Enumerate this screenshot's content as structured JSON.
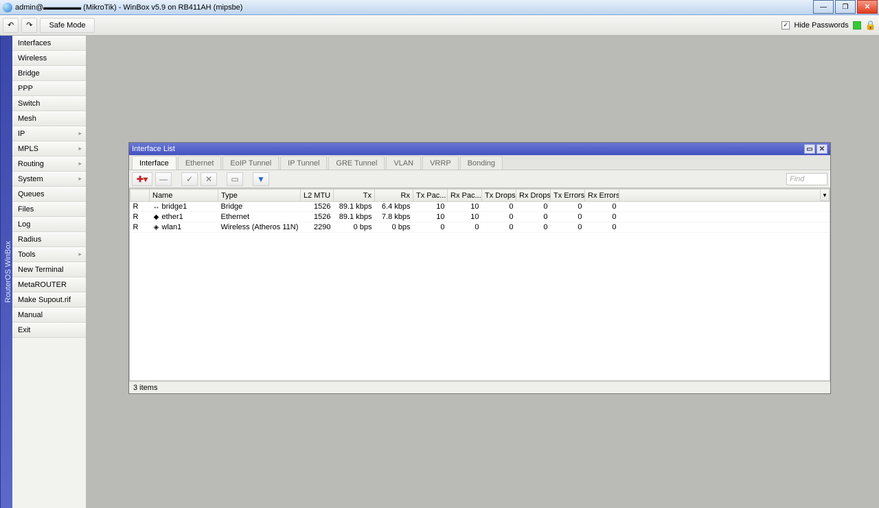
{
  "titlebar": {
    "text": "admin@▬▬▬▬▬ (MikroTik) - WinBox v5.9 on RB411AH (mipsbe)"
  },
  "toolbar": {
    "undo_glyph": "↶",
    "redo_glyph": "↷",
    "safe_mode": "Safe Mode",
    "hide_passwords": "Hide Passwords",
    "hide_passwords_checked": "✓"
  },
  "vbar_label": "RouterOS WinBox",
  "sidebar": {
    "items": [
      {
        "label": "Interfaces",
        "sub": false
      },
      {
        "label": "Wireless",
        "sub": false
      },
      {
        "label": "Bridge",
        "sub": false
      },
      {
        "label": "PPP",
        "sub": false
      },
      {
        "label": "Switch",
        "sub": false
      },
      {
        "label": "Mesh",
        "sub": false
      },
      {
        "label": "IP",
        "sub": true
      },
      {
        "label": "MPLS",
        "sub": true
      },
      {
        "label": "Routing",
        "sub": true
      },
      {
        "label": "System",
        "sub": true
      },
      {
        "label": "Queues",
        "sub": false
      },
      {
        "label": "Files",
        "sub": false
      },
      {
        "label": "Log",
        "sub": false
      },
      {
        "label": "Radius",
        "sub": false
      },
      {
        "label": "Tools",
        "sub": true
      },
      {
        "label": "New Terminal",
        "sub": false
      },
      {
        "label": "MetaROUTER",
        "sub": false
      },
      {
        "label": "Make Supout.rif",
        "sub": false
      },
      {
        "label": "Manual",
        "sub": false
      },
      {
        "label": "Exit",
        "sub": false
      }
    ]
  },
  "inner": {
    "title": "Interface List",
    "tabs": [
      "Interface",
      "Ethernet",
      "EoIP Tunnel",
      "IP Tunnel",
      "GRE Tunnel",
      "VLAN",
      "VRRP",
      "Bonding"
    ],
    "active_tab": 0,
    "find_placeholder": "Find",
    "columns": [
      "",
      "Name",
      "Type",
      "L2 MTU",
      "Tx",
      "Rx",
      "Tx Pac...",
      "Rx Pac...",
      "Tx Drops",
      "Rx Drops",
      "Tx Errors",
      "Rx Errors"
    ],
    "rows": [
      {
        "flag": "R",
        "icon": "↔",
        "name": "bridge1",
        "type": "Bridge",
        "l2mtu": "1526",
        "tx": "89.1 kbps",
        "rx": "6.4 kbps",
        "txp": "10",
        "rxp": "10",
        "txd": "0",
        "rxd": "0",
        "txe": "0",
        "rxe": "0"
      },
      {
        "flag": "R",
        "icon": "◆",
        "name": "ether1",
        "type": "Ethernet",
        "l2mtu": "1526",
        "tx": "89.1 kbps",
        "rx": "7.8 kbps",
        "txp": "10",
        "rxp": "10",
        "txd": "0",
        "rxd": "0",
        "txe": "0",
        "rxe": "0"
      },
      {
        "flag": "R",
        "icon": "◈",
        "name": "wlan1",
        "type": "Wireless (Atheros 11N)",
        "l2mtu": "2290",
        "tx": "0 bps",
        "rx": "0 bps",
        "txp": "0",
        "rxp": "0",
        "txd": "0",
        "rxd": "0",
        "txe": "0",
        "rxe": "0"
      }
    ],
    "status": "3 items"
  }
}
